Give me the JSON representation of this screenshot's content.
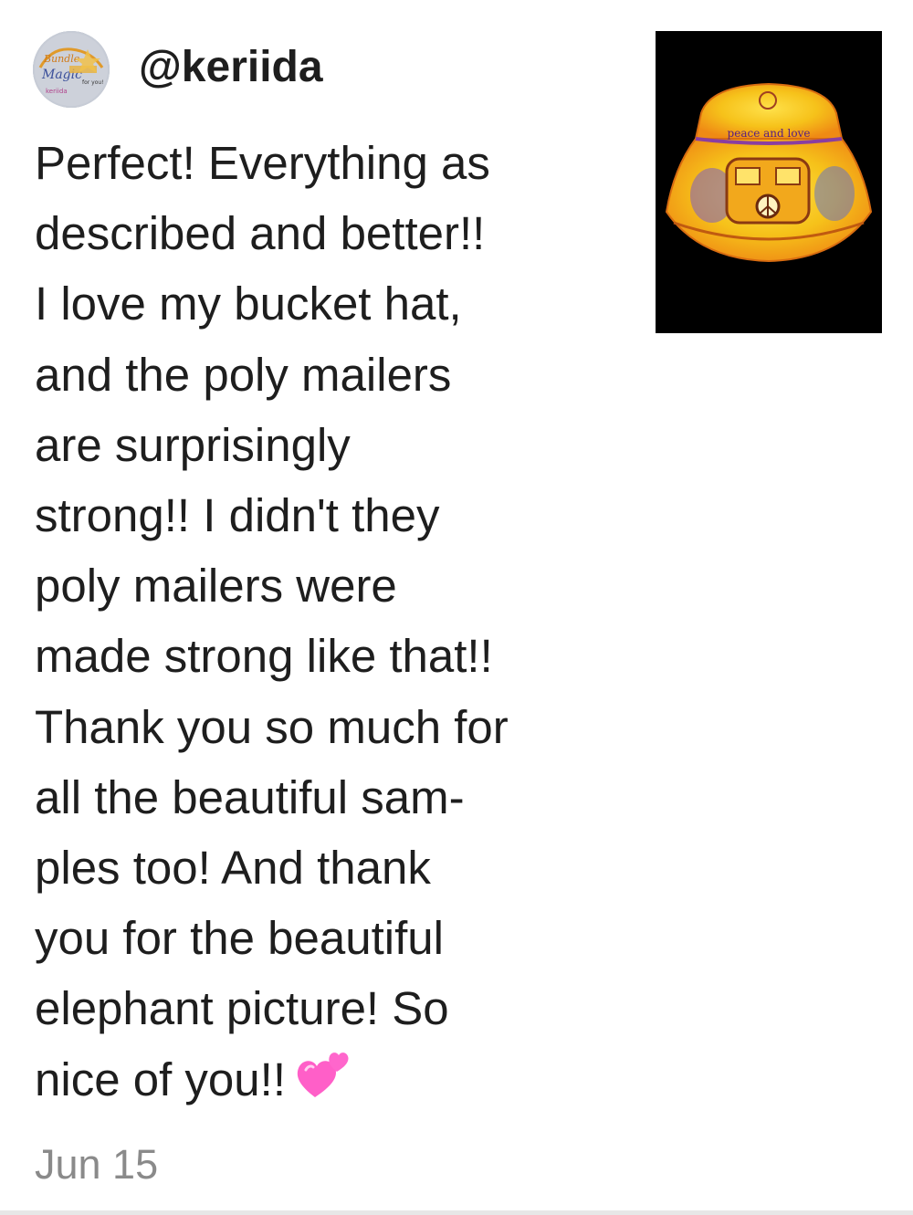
{
  "review": {
    "username": "@keriida",
    "avatar_icon": "shop-logo-avatar-icon",
    "text_lines": [
      "Perfect! Everything as",
      "described and better!!",
      "I love my bucket hat,",
      "and the poly mailers",
      "are surprisingly",
      "strong!! I didn't they",
      "poly mailers were",
      "made strong like that!!",
      "Thank you so much for",
      "all the beautiful sam-",
      "ples too! And thank",
      "you for the beautiful",
      "elephant picture! So",
      "nice of you!!"
    ],
    "emoji": "two-hearts-icon",
    "date": "Jun 15"
  },
  "product": {
    "image_icon": "bucket-hat-thumbnail",
    "hat_text": "peace and love"
  },
  "colors": {
    "text": "#1e1e1e",
    "date": "#8a8a8a",
    "heart": "#ff5fc8",
    "thumb_bg": "#000000",
    "hat_yellow": "#f6c21a",
    "hat_orange": "#f08a16"
  }
}
